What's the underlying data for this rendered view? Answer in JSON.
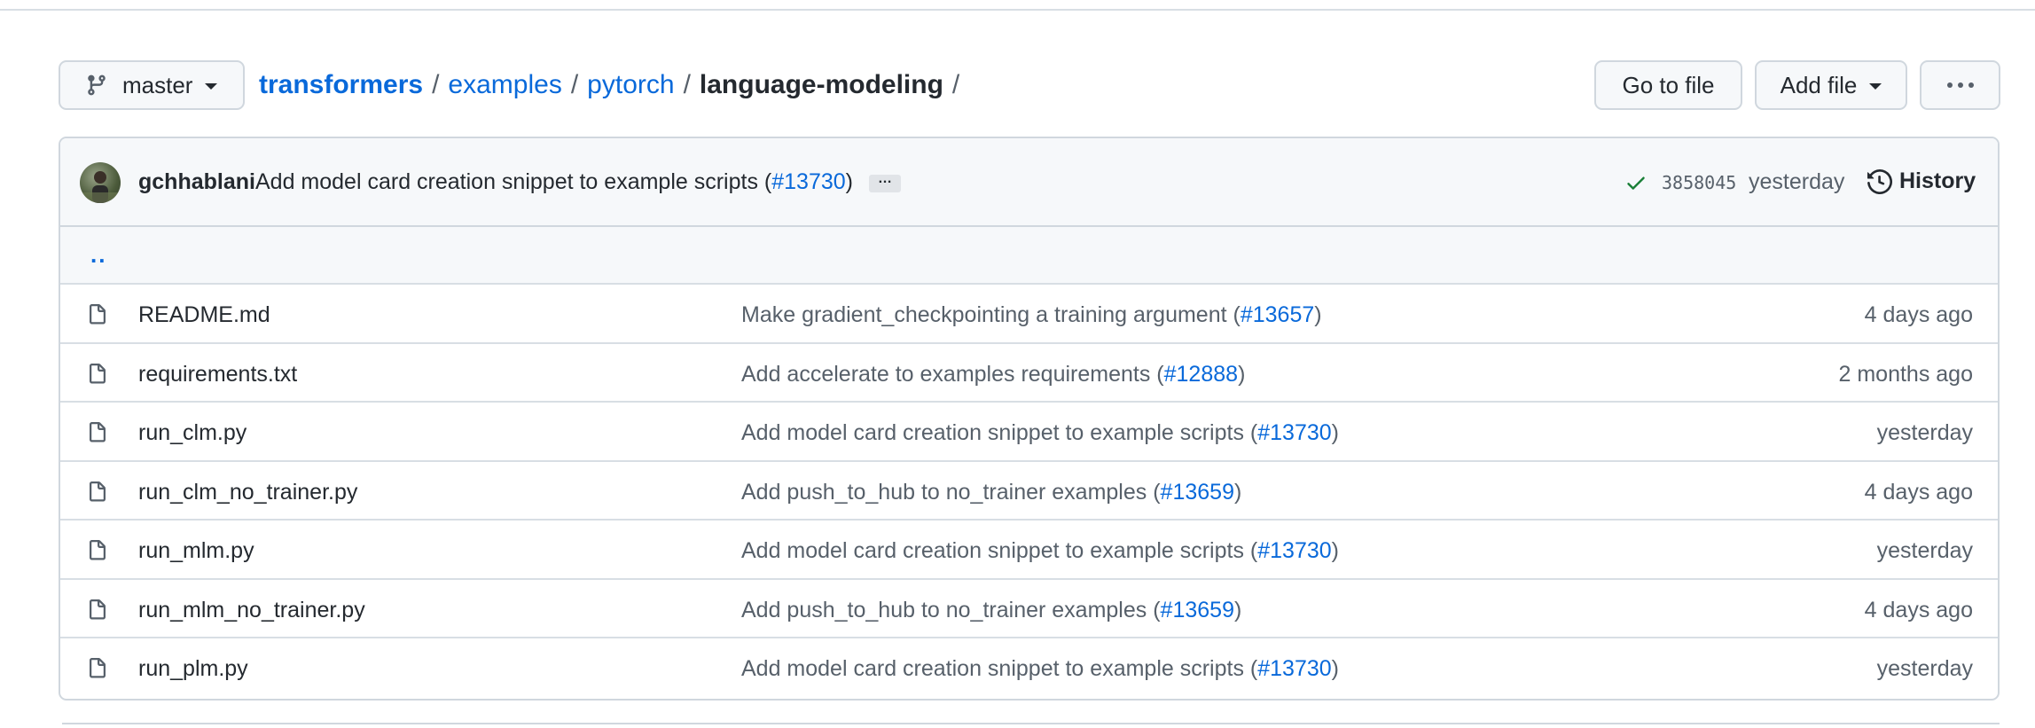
{
  "branch": {
    "name": "master"
  },
  "breadcrumb": {
    "repo": "transformers",
    "parts": [
      "examples",
      "pytorch"
    ],
    "current": "language-modeling",
    "separator": "/"
  },
  "actions": {
    "go_to_file": "Go to file",
    "add_file": "Add file"
  },
  "latest_commit": {
    "author": "gchhablani",
    "message": "Add model card creation snippet to example scripts (",
    "pr": "#13730",
    "message_end": ")",
    "ellipsis": "…",
    "sha": "3858045",
    "time": "yesterday",
    "history_label": "History"
  },
  "parent_dir": "..",
  "files": [
    {
      "name": "README.md",
      "msg_pre": "Make gradient_checkpointing a training argument (",
      "pr": "#13657",
      "msg_post": ")",
      "time": "4 days ago"
    },
    {
      "name": "requirements.txt",
      "msg_pre": "Add accelerate to examples requirements (",
      "pr": "#12888",
      "msg_post": ")",
      "time": "2 months ago"
    },
    {
      "name": "run_clm.py",
      "msg_pre": "Add model card creation snippet to example scripts (",
      "pr": "#13730",
      "msg_post": ")",
      "time": "yesterday"
    },
    {
      "name": "run_clm_no_trainer.py",
      "msg_pre": "Add push_to_hub to no_trainer examples (",
      "pr": "#13659",
      "msg_post": ")",
      "time": "4 days ago"
    },
    {
      "name": "run_mlm.py",
      "msg_pre": "Add model card creation snippet to example scripts (",
      "pr": "#13730",
      "msg_post": ")",
      "time": "yesterday"
    },
    {
      "name": "run_mlm_no_trainer.py",
      "msg_pre": "Add push_to_hub to no_trainer examples (",
      "pr": "#13659",
      "msg_post": ")",
      "time": "4 days ago"
    },
    {
      "name": "run_plm.py",
      "msg_pre": "Add model card creation snippet to example scripts (",
      "pr": "#13730",
      "msg_post": ")",
      "time": "yesterday"
    }
  ],
  "colors": {
    "link": "#0969da",
    "success": "#1a7f37",
    "border": "#d0d7de",
    "muted": "#57606a"
  }
}
